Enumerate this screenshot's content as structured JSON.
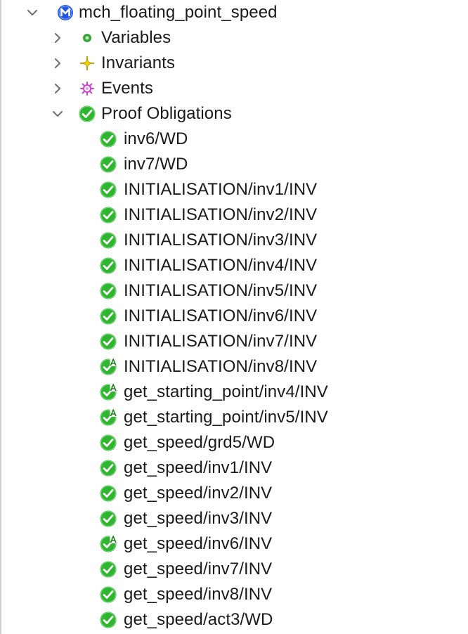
{
  "tree": {
    "root": {
      "label": "mch_floating_point_speed",
      "expanded": true,
      "icon": "machine-m-icon"
    },
    "variables": {
      "label": "Variables",
      "expanded": false,
      "icon": "variable-dot-icon"
    },
    "invariants": {
      "label": "Invariants",
      "expanded": false,
      "icon": "invariant-star-icon"
    },
    "events": {
      "label": "Events",
      "expanded": false,
      "icon": "event-gear-icon"
    },
    "proof_obligations": {
      "label": "Proof Obligations",
      "expanded": true,
      "icon": "check-circle-icon"
    },
    "po_items": [
      {
        "label": "inv6/WD",
        "status": "discharged"
      },
      {
        "label": "inv7/WD",
        "status": "discharged"
      },
      {
        "label": "INITIALISATION/inv1/INV",
        "status": "discharged"
      },
      {
        "label": "INITIALISATION/inv2/INV",
        "status": "discharged"
      },
      {
        "label": "INITIALISATION/inv3/INV",
        "status": "discharged"
      },
      {
        "label": "INITIALISATION/inv4/INV",
        "status": "discharged"
      },
      {
        "label": "INITIALISATION/inv5/INV",
        "status": "discharged"
      },
      {
        "label": "INITIALISATION/inv6/INV",
        "status": "discharged"
      },
      {
        "label": "INITIALISATION/inv7/INV",
        "status": "discharged"
      },
      {
        "label": "INITIALISATION/inv8/INV",
        "status": "auto-discharged"
      },
      {
        "label": "get_starting_point/inv4/INV",
        "status": "auto-discharged"
      },
      {
        "label": "get_starting_point/inv5/INV",
        "status": "auto-discharged"
      },
      {
        "label": "get_speed/grd5/WD",
        "status": "discharged"
      },
      {
        "label": "get_speed/inv1/INV",
        "status": "discharged"
      },
      {
        "label": "get_speed/inv2/INV",
        "status": "discharged"
      },
      {
        "label": "get_speed/inv3/INV",
        "status": "discharged"
      },
      {
        "label": "get_speed/inv6/INV",
        "status": "auto-discharged"
      },
      {
        "label": "get_speed/inv7/INV",
        "status": "discharged"
      },
      {
        "label": "get_speed/inv8/INV",
        "status": "discharged"
      },
      {
        "label": "get_speed/act3/WD",
        "status": "discharged"
      }
    ]
  },
  "colors": {
    "check_green": "#2fb52f",
    "machine_blue": "#1f55e0",
    "variable_green": "#3aa53a",
    "invariant_yellow": "#d9b300",
    "event_magenta": "#d23fd2",
    "chevron_gray": "#6e6e6e"
  }
}
